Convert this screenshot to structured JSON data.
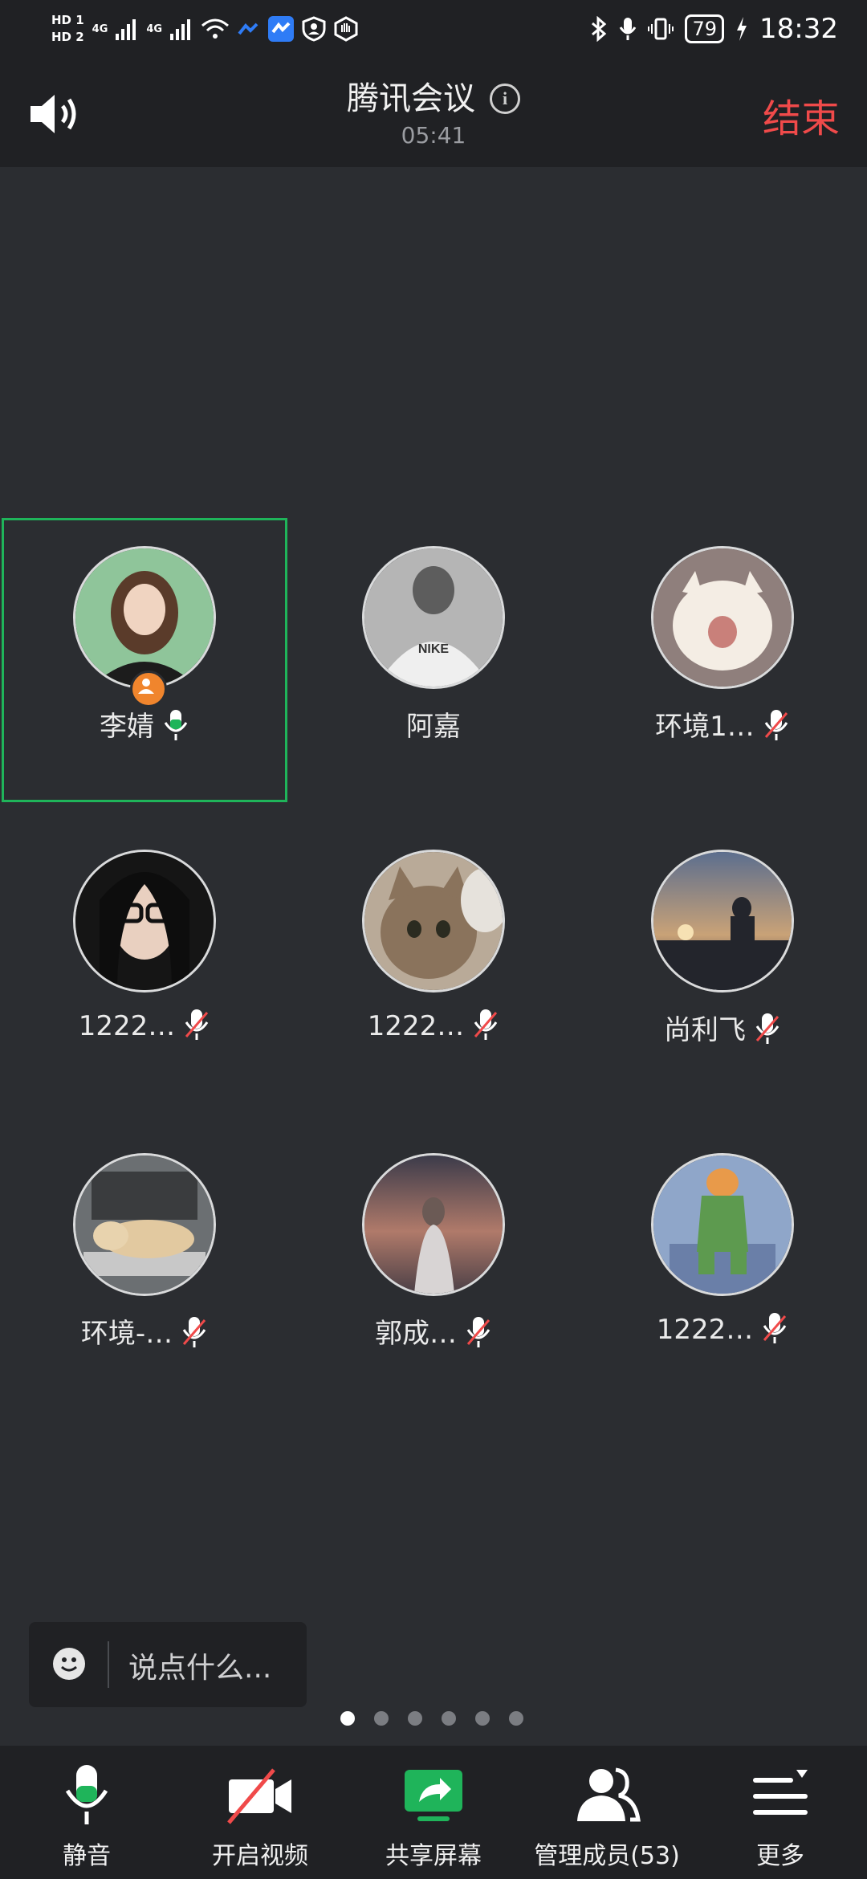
{
  "status_bar": {
    "hd1": "HD 1",
    "hd2": "HD 2",
    "net1": "4G",
    "net2": "4G",
    "battery": "79",
    "time": "18:32"
  },
  "header": {
    "title": "腾讯会议",
    "timer": "05:41",
    "end_label": "结束"
  },
  "participants": [
    {
      "name": "李婧",
      "mic": "on",
      "host": true,
      "active": true
    },
    {
      "name": "阿嘉",
      "mic": "none"
    },
    {
      "name": "环境1…",
      "mic": "muted"
    },
    {
      "name": "1222…",
      "mic": "muted"
    },
    {
      "name": "1222…",
      "mic": "muted"
    },
    {
      "name": "尚利飞",
      "mic": "muted"
    },
    {
      "name": "环境-…",
      "mic": "muted"
    },
    {
      "name": "郭成…",
      "mic": "muted"
    },
    {
      "name": "1222…",
      "mic": "muted"
    }
  ],
  "chat": {
    "placeholder": "说点什么..."
  },
  "pager": {
    "count": 6,
    "current": 1
  },
  "toolbar": {
    "mute_label": "静音",
    "video_label": "开启视频",
    "share_label": "共享屏幕",
    "members_label": "管理成员(53)",
    "more_label": "更多"
  },
  "colors": {
    "accent_green": "#1fb45a",
    "end_red": "#f04a4a",
    "host_orange": "#f0852d",
    "background": "#2b2d31"
  }
}
